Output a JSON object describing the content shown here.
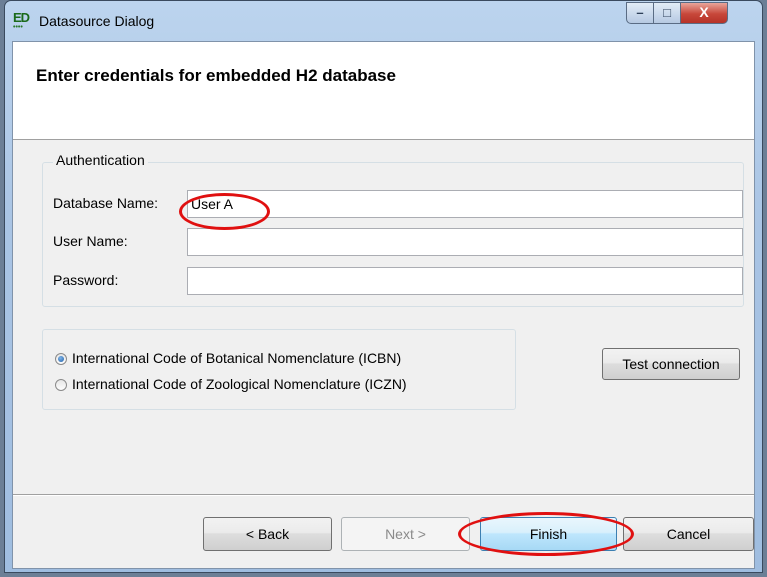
{
  "window": {
    "title": "Datasource Dialog",
    "app_icon_text": "ED",
    "controls": {
      "minimize": "–",
      "maximize": "□",
      "close": "X"
    }
  },
  "banner": {
    "title": "Enter credentials for embedded H2 database"
  },
  "authentication": {
    "legend": "Authentication",
    "database_name": {
      "label": "Database Name:",
      "value": "User A"
    },
    "user_name": {
      "label": "User Name:",
      "value": ""
    },
    "password": {
      "label": "Password:",
      "value": ""
    }
  },
  "nomenclature": {
    "options": [
      {
        "label": "International Code of Botanical Nomenclature (ICBN)",
        "selected": true
      },
      {
        "label": "International Code of Zoological Nomenclature (ICZN)",
        "selected": false
      }
    ]
  },
  "buttons": {
    "test_connection": "Test connection",
    "back": "< Back",
    "next": "Next >",
    "finish": "Finish",
    "cancel": "Cancel"
  },
  "colors": {
    "annotation_circle": "#e01010",
    "default_button_border": "#3c7fb1"
  }
}
